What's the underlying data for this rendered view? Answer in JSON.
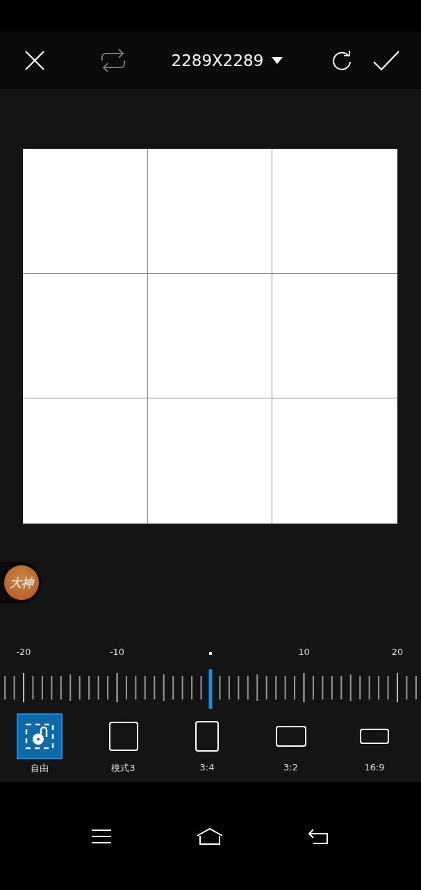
{
  "toolbar": {
    "size_label": "2289X2289"
  },
  "floating_badge": {
    "text": "大神"
  },
  "ruler": {
    "labels": [
      "-20",
      "-10",
      "10",
      "20"
    ]
  },
  "aspect_options": [
    {
      "kind": "free",
      "label": "自由",
      "selected": true
    },
    {
      "kind": "square",
      "label": "模式3",
      "selected": false
    },
    {
      "kind": "portrait",
      "label": "3:4",
      "selected": false
    },
    {
      "kind": "landscape",
      "label": "3:2",
      "selected": false
    },
    {
      "kind": "wide",
      "label": "16:9",
      "selected": false
    }
  ]
}
